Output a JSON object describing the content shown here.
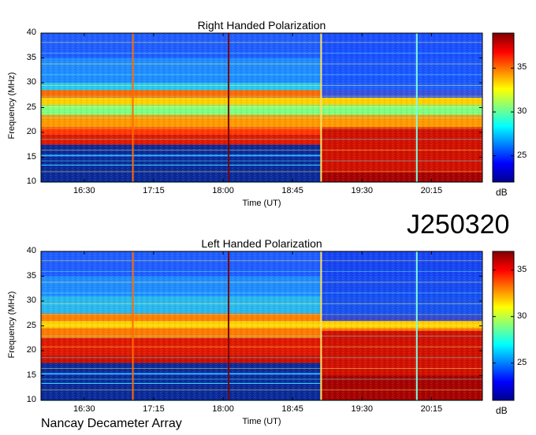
{
  "page": {
    "date_label": "J250320",
    "footer": "Nancay Decameter Array"
  },
  "chart_data": [
    {
      "type": "heatmap",
      "title": "Right Handed Polarization",
      "xlabel": "Time (UT)",
      "ylabel": "Frequency (MHz)",
      "x_ticks": [
        "16:30",
        "17:15",
        "18:00",
        "18:45",
        "19:30",
        "20:15"
      ],
      "y_ticks": [
        10,
        15,
        20,
        25,
        30,
        35,
        40
      ],
      "ylim": [
        10,
        40
      ],
      "colorbar": {
        "ticks": [
          25,
          30,
          35
        ],
        "range": [
          22,
          39
        ],
        "unit": "dB"
      },
      "features": {
        "vertical_lines_time": [
          "17:01",
          "18:03",
          "19:03",
          "20:05"
        ],
        "strong_band_mhz": [
          17,
          29
        ],
        "quiet_below_mhz_until": "19:03"
      }
    },
    {
      "type": "heatmap",
      "title": "Left Handed Polarization",
      "xlabel": "Time (UT)",
      "ylabel": "Frequency (MHz)",
      "x_ticks": [
        "16:30",
        "17:15",
        "18:00",
        "18:45",
        "19:30",
        "20:15"
      ],
      "y_ticks": [
        10,
        15,
        20,
        25,
        30,
        35,
        40
      ],
      "ylim": [
        10,
        40
      ],
      "colorbar": {
        "ticks": [
          25,
          30,
          35
        ],
        "range": [
          21,
          37
        ],
        "unit": "dB"
      },
      "features": {
        "vertical_lines_time": [
          "17:01",
          "18:03",
          "19:03",
          "20:05"
        ],
        "strong_band_mhz": [
          17,
          24
        ],
        "quiet_below_mhz_until": "19:03"
      }
    }
  ]
}
